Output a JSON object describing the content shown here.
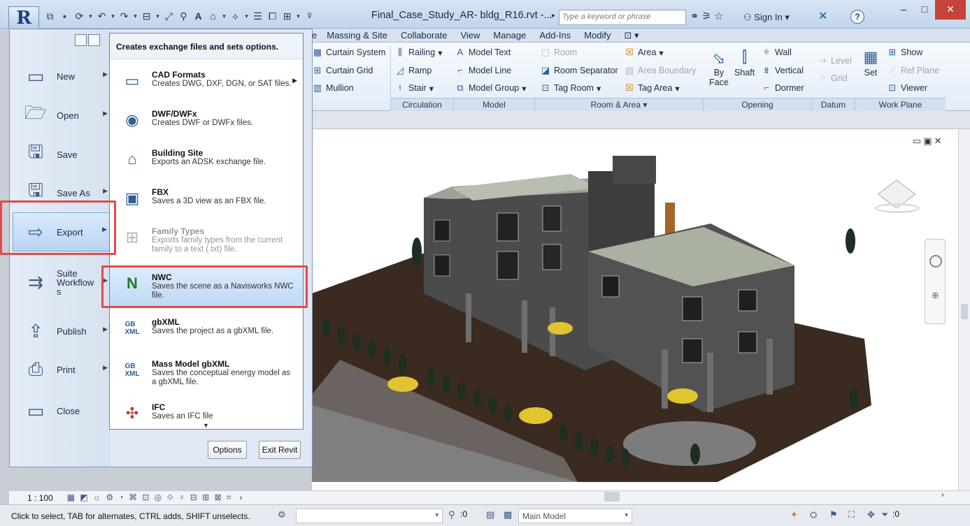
{
  "titlebar": {
    "document_title": "Final_Case_Study_AR- bldg_R16.rvt -...",
    "search_placeholder": "Type a keyword or phrase",
    "sign_in": "Sign In",
    "help": "?",
    "qat_icons": [
      "open-icon",
      "save-icon",
      "sync-icon",
      "undo-icon",
      "redo-icon",
      "measure-icon",
      "dimension-icon",
      "tag-icon",
      "text-icon",
      "3d-view-icon",
      "section-icon",
      "thin-lines-icon",
      "close-hidden-icon",
      "switch-windows-icon"
    ]
  },
  "ribbon": {
    "tabs": [
      "e",
      "Massing & Site",
      "Collaborate",
      "View",
      "Manage",
      "Add-Ins",
      "Modify",
      "⊡ ▾"
    ],
    "items": {
      "curtain_system": "Curtain System",
      "curtain_grid": "Curtain Grid",
      "mullion": "Mullion",
      "railing": "Railing",
      "ramp": "Ramp",
      "stair": "Stair",
      "model_text": "Model Text",
      "model_line": "Model Line",
      "model_group": "Model Group",
      "room": "Room",
      "room_separator": "Room Separator",
      "tag_room": "Tag Room",
      "area": "Area",
      "area_boundary": "Area Boundary",
      "tag_area": "Tag Area",
      "by_face_1": "By",
      "by_face_2": "Face",
      "shaft": "Shaft",
      "wall": "Wall",
      "vertical": "Vertical",
      "dormer": "Dormer",
      "level": "Level",
      "grid": "Grid",
      "set": "Set",
      "show": "Show",
      "ref_plane": "Ref Plane",
      "viewer": "Viewer"
    },
    "panels": {
      "circulation": "Circulation",
      "model": "Model",
      "room_area": "Room & Area ▾",
      "opening": "Opening",
      "datum": "Datum",
      "work_plane": "Work Plane"
    }
  },
  "app_menu": {
    "items": [
      {
        "label": "New",
        "icon": "new-document-icon"
      },
      {
        "label": "Open",
        "icon": "open-folder-icon"
      },
      {
        "label": "Save",
        "icon": "floppy-disk-icon"
      },
      {
        "label": "Save As",
        "icon": "save-as-icon"
      },
      {
        "label": "Export",
        "icon": "export-icon"
      },
      {
        "label": "Suite Workflows",
        "line1": "Suite",
        "line2": "Workflow",
        "line3": "s",
        "icon": "suite-workflows-icon"
      },
      {
        "label": "Publish",
        "icon": "publish-icon"
      },
      {
        "label": "Print",
        "icon": "printer-icon"
      },
      {
        "label": "Close",
        "icon": "close-document-icon"
      }
    ],
    "submenu_header": "Creates exchange files and sets options.",
    "submenu": [
      {
        "title": "CAD Formats",
        "desc": "Creates DWG, DXF, DGN, or SAT files.",
        "icon": "cad-icon"
      },
      {
        "title": "DWF/DWFx",
        "desc": "Creates DWF or DWFx files.",
        "icon": "dwf-globe-icon"
      },
      {
        "title": "Building Site",
        "desc": "Exports an ADSK exchange file.",
        "icon": "building-site-icon"
      },
      {
        "title": "FBX",
        "desc": "Saves a 3D view as an FBX file.",
        "icon": "fbx-icon"
      },
      {
        "title": "Family Types",
        "desc": "Exports family types from the current family to a text (.txt) file.",
        "icon": "family-types-icon"
      },
      {
        "title": "NWC",
        "desc": "Saves the scene as a Navisworks NWC file.",
        "icon": "navisworks-icon"
      },
      {
        "title": "gbXML",
        "desc": "Saves the project as a gbXML file.",
        "icon": "gbxml-icon"
      },
      {
        "title": "Mass Model gbXML",
        "desc": "Saves the conceptual energy model as a gbXML file.",
        "icon": "mass-gbxml-icon"
      },
      {
        "title": "IFC",
        "desc": "Saves an IFC file",
        "icon": "ifc-icon"
      }
    ],
    "options_button": "Options",
    "exit_button": "Exit Revit"
  },
  "viewbar": {
    "scale": "1 : 100"
  },
  "statusbar": {
    "hint": "Click to select, TAB for alternates, CTRL adds, SHIFT unselects.",
    "selection_count": ":0",
    "model": "Main Model",
    "filter_count": ":0"
  },
  "colors": {
    "highlight": "#e04b4b",
    "ground": "#3b2a20",
    "selection": "#bfd8f3"
  }
}
